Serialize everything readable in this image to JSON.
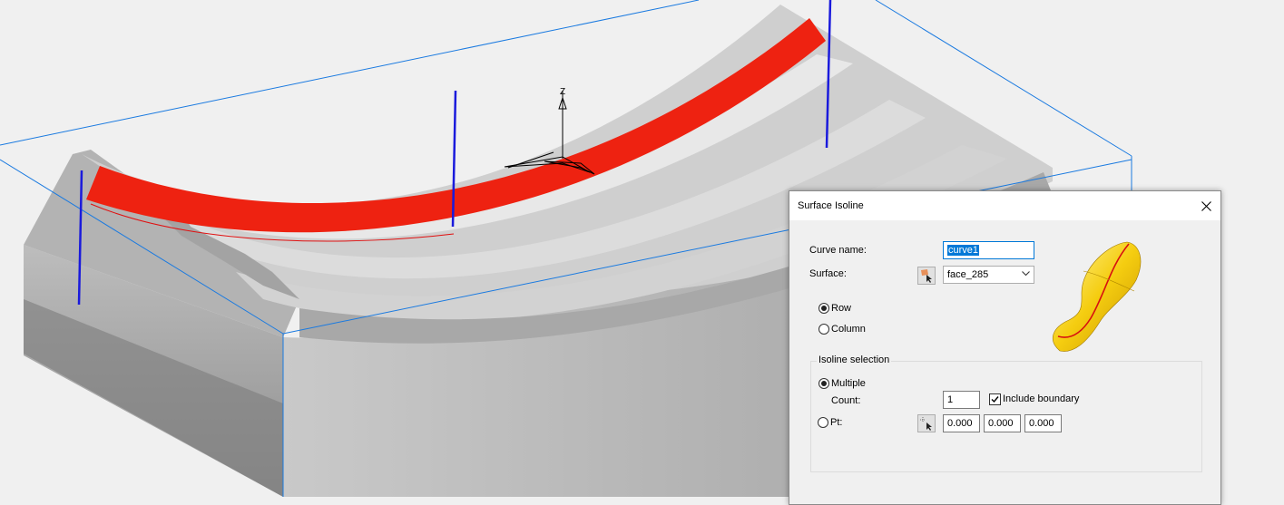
{
  "dialog": {
    "title": "Surface Isoline",
    "close_icon": "close-icon",
    "curve_name_label": "Curve name:",
    "curve_name_value": "curve1",
    "surface_label": "Surface:",
    "surface_value": "face_285",
    "surface_pick_icon": "surface-pick-icon",
    "direction": {
      "row_label": "Row",
      "column_label": "Column",
      "selected": "Row"
    },
    "preview_icon": "isoline-preview-icon",
    "isoline_selection": {
      "group_title": "Isoline selection",
      "multiple_label": "Multiple",
      "count_label": "Count:",
      "count_value": "1",
      "include_boundary_label": "Include boundary",
      "include_boundary_checked": true,
      "pt_label": "Pt:",
      "pt_pick_icon": "point-pick-icon",
      "pt_x": "0.000",
      "pt_y": "0.000",
      "pt_z": "0.000",
      "selected": "Multiple"
    }
  },
  "viewport": {
    "axis_label": "Z",
    "part_color": "#c4c4c4",
    "highlight_face_color": "#ee2211",
    "bounding_box_color": "#1a7ae0",
    "isoline_color": "#1a1adc"
  }
}
